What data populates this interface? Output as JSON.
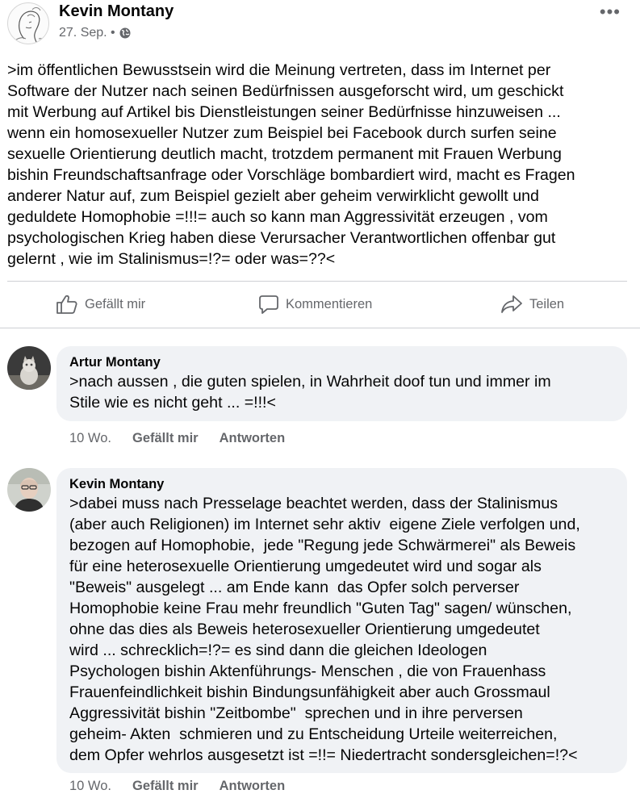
{
  "post": {
    "author": "Kevin Montany",
    "date": "27. Sep. •",
    "privacy_icon": "globe-icon",
    "more_icon": "•••",
    "text": ">im öffentlichen Bewusstsein wird die Meinung vertreten, dass im Internet per\nSoftware der Nutzer nach seinen Bedürfnissen ausgeforscht wird, um geschickt\nmit Werbung auf Artikel bis Dienstleistungen seiner Bedürfnisse hinzuweisen ...\nwenn ein homosexueller Nutzer zum Beispiel bei Facebook durch surfen seine\nsexuelle Orientierung deutlich macht, trotzdem permanent mit Frauen Werbung\nbishin Freundschaftsanfrage oder Vorschläge bombardiert wird, macht es Fragen\nanderer Natur auf, zum Beispiel gezielt aber geheim verwirklicht gewollt und\ngeduldete Homophobie =!!!= auch so kann man Aggressivität erzeugen , vom\npsychologischen Krieg haben diese Verursacher Verantwortlichen offenbar gut\ngelernt , wie im Stalinismus=!?= oder was=??<"
  },
  "actions": {
    "like": "Gefällt mir",
    "comment": "Kommentieren",
    "share": "Teilen"
  },
  "comments": [
    {
      "author": "Artur Montany",
      "text": ">nach aussen , die guten spielen, in Wahrheit doof tun und immer im\nStile wie es nicht geht ... =!!!<",
      "time": "10 Wo.",
      "like": "Gefällt mir",
      "reply": "Antworten"
    },
    {
      "author": "Kevin Montany",
      "text": ">dabei muss nach Presselage beachtet werden, dass der Stalinismus\n(aber auch Religionen) im Internet sehr aktiv  eigene Ziele verfolgen und,\nbezogen auf Homophobie,  jede \"Regung jede Schwärmerei\" als Beweis\nfür eine heterosexuelle Orientierung umgedeutet wird und sogar als\n\"Beweis\" ausgelegt ... am Ende kann  das Opfer solch perverser\nHomophobie keine Frau mehr freundlich \"Guten Tag\" sagen/ wünschen,\nohne das dies als Beweis heterosexueller Orientierung umgedeutet\nwird ... schrecklich=!?= es sind dann die gleichen Ideologen\nPsychologen bishin Aktenführungs- Menschen , die von Frauenhass\nFrauenfeindlichkeit bishin Bindungsunfähigkeit aber auch Grossmaul\nAggressivität bishin \"Zeitbombe\"  sprechen und in ihre perversen\ngeheim- Akten  schmieren und zu Entscheidung Urteile weiterreichen,\ndem Opfer wehrlos ausgesetzt ist =!!= Niedertracht sondersgleichen=!?<",
      "time": "10 Wo.",
      "like": "Gefällt mir",
      "reply": "Antworten"
    }
  ],
  "colors": {
    "text": "#050505",
    "secondary": "#65676b",
    "bubble": "#f0f2f5",
    "divider": "#ced0d4"
  }
}
